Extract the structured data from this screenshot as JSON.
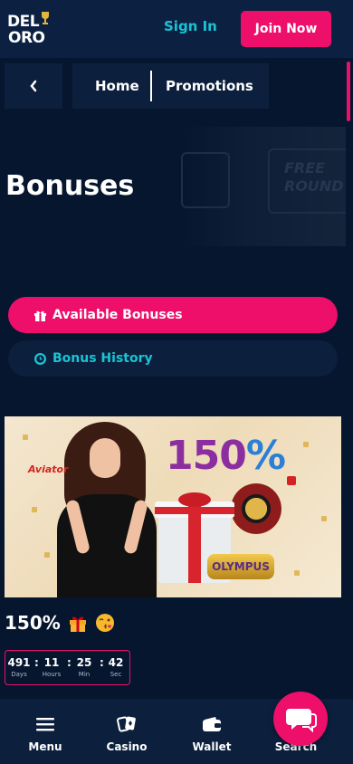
{
  "header": {
    "logo_line1": "DEL",
    "logo_line2": "ORO",
    "signin_label": "Sign In",
    "join_label": "Join Now"
  },
  "breadcrumb": {
    "home": "Home",
    "current": "Promotions"
  },
  "hero": {
    "bg_text_line1": "FREE",
    "bg_text_line2": "ROUND"
  },
  "page": {
    "title": "Bonuses"
  },
  "tabs": [
    {
      "label": "Available Bonuses",
      "icon": "gift-icon",
      "active": true
    },
    {
      "label": "Bonus History",
      "icon": "history-icon",
      "active": false
    }
  ],
  "promo": {
    "image_percent_main": "150",
    "image_percent_sign": "%",
    "image_brand_aviator": "Aviator",
    "image_brand_olympus": "OLYMPUS",
    "title": "150%",
    "emojis": [
      "gift-emoji",
      "kiss-face-emoji"
    ],
    "countdown": [
      {
        "value": "491",
        "label": "Days"
      },
      {
        "value": "11",
        "label": "Hours"
      },
      {
        "value": "25",
        "label": "Min"
      },
      {
        "value": "42",
        "label": "Sec"
      }
    ]
  },
  "bottom_nav": [
    {
      "label": "Menu",
      "icon": "hamburger-icon"
    },
    {
      "label": "Casino",
      "icon": "cards-icon"
    },
    {
      "label": "Wallet",
      "icon": "wallet-icon"
    },
    {
      "label": "Search",
      "icon": "search-icon"
    }
  ],
  "colors": {
    "background": "#07162f",
    "panel": "#0c1f3d",
    "accent_pink": "#ed0f6a",
    "accent_cyan": "#19c4d4"
  }
}
